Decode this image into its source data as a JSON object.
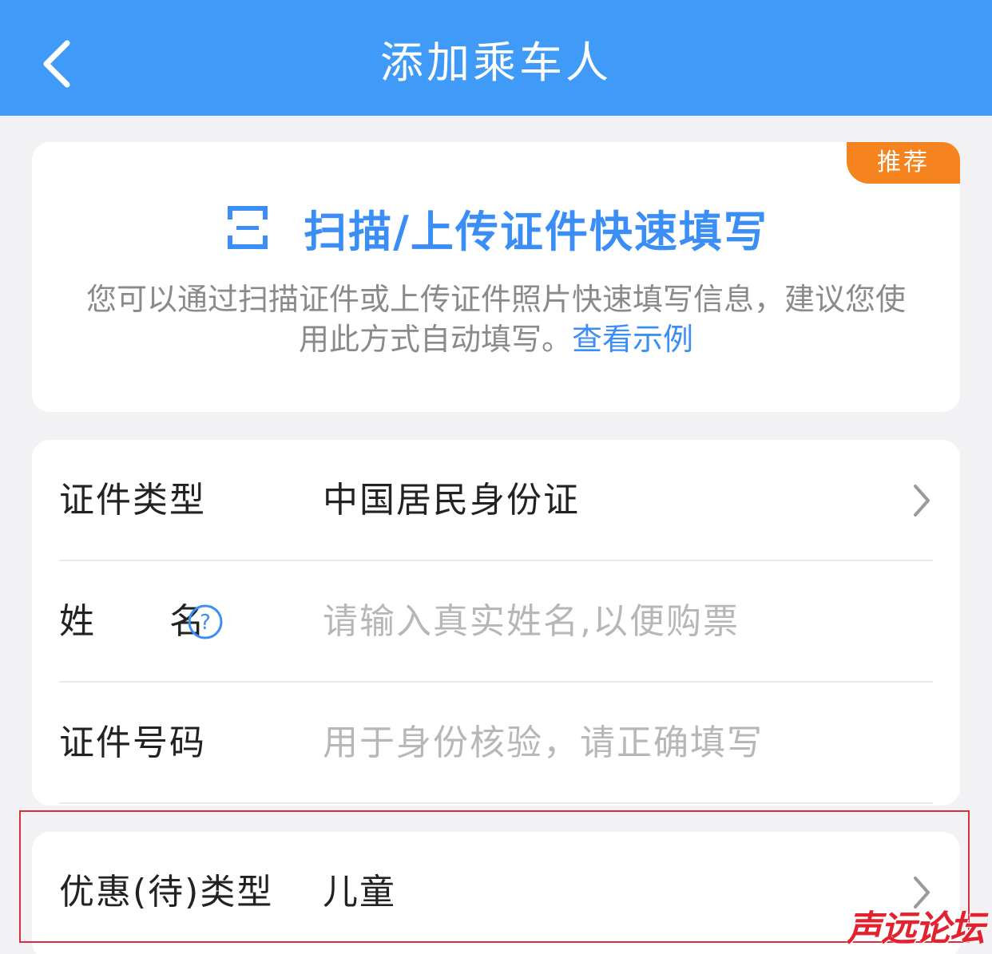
{
  "header": {
    "title": "添加乘车人",
    "back_icon": "chevron-left-icon",
    "background": "#3f9af8"
  },
  "scan_card": {
    "badge": "推荐",
    "badge_color": "#f5841f",
    "icon": "scan-icon",
    "title": "扫描/上传证件快速填写",
    "description": "您可以通过扫描证件或上传证件照片快速填写信息，建议您使用此方式自动填写。",
    "example_link": "查看示例",
    "accent": "#3a8ef5"
  },
  "form": {
    "id_type": {
      "label": "证件类型",
      "value": "中国居民身份证"
    },
    "name": {
      "label": "姓　　名",
      "placeholder": "请输入真实姓名,以便购票",
      "help_icon": "question-circle-icon"
    },
    "id_number": {
      "label": "证件号码",
      "placeholder": "用于身份核验，请正确填写"
    }
  },
  "discount": {
    "label": "优惠(待)类型",
    "value": "儿童"
  },
  "watermark": "声远论坛"
}
